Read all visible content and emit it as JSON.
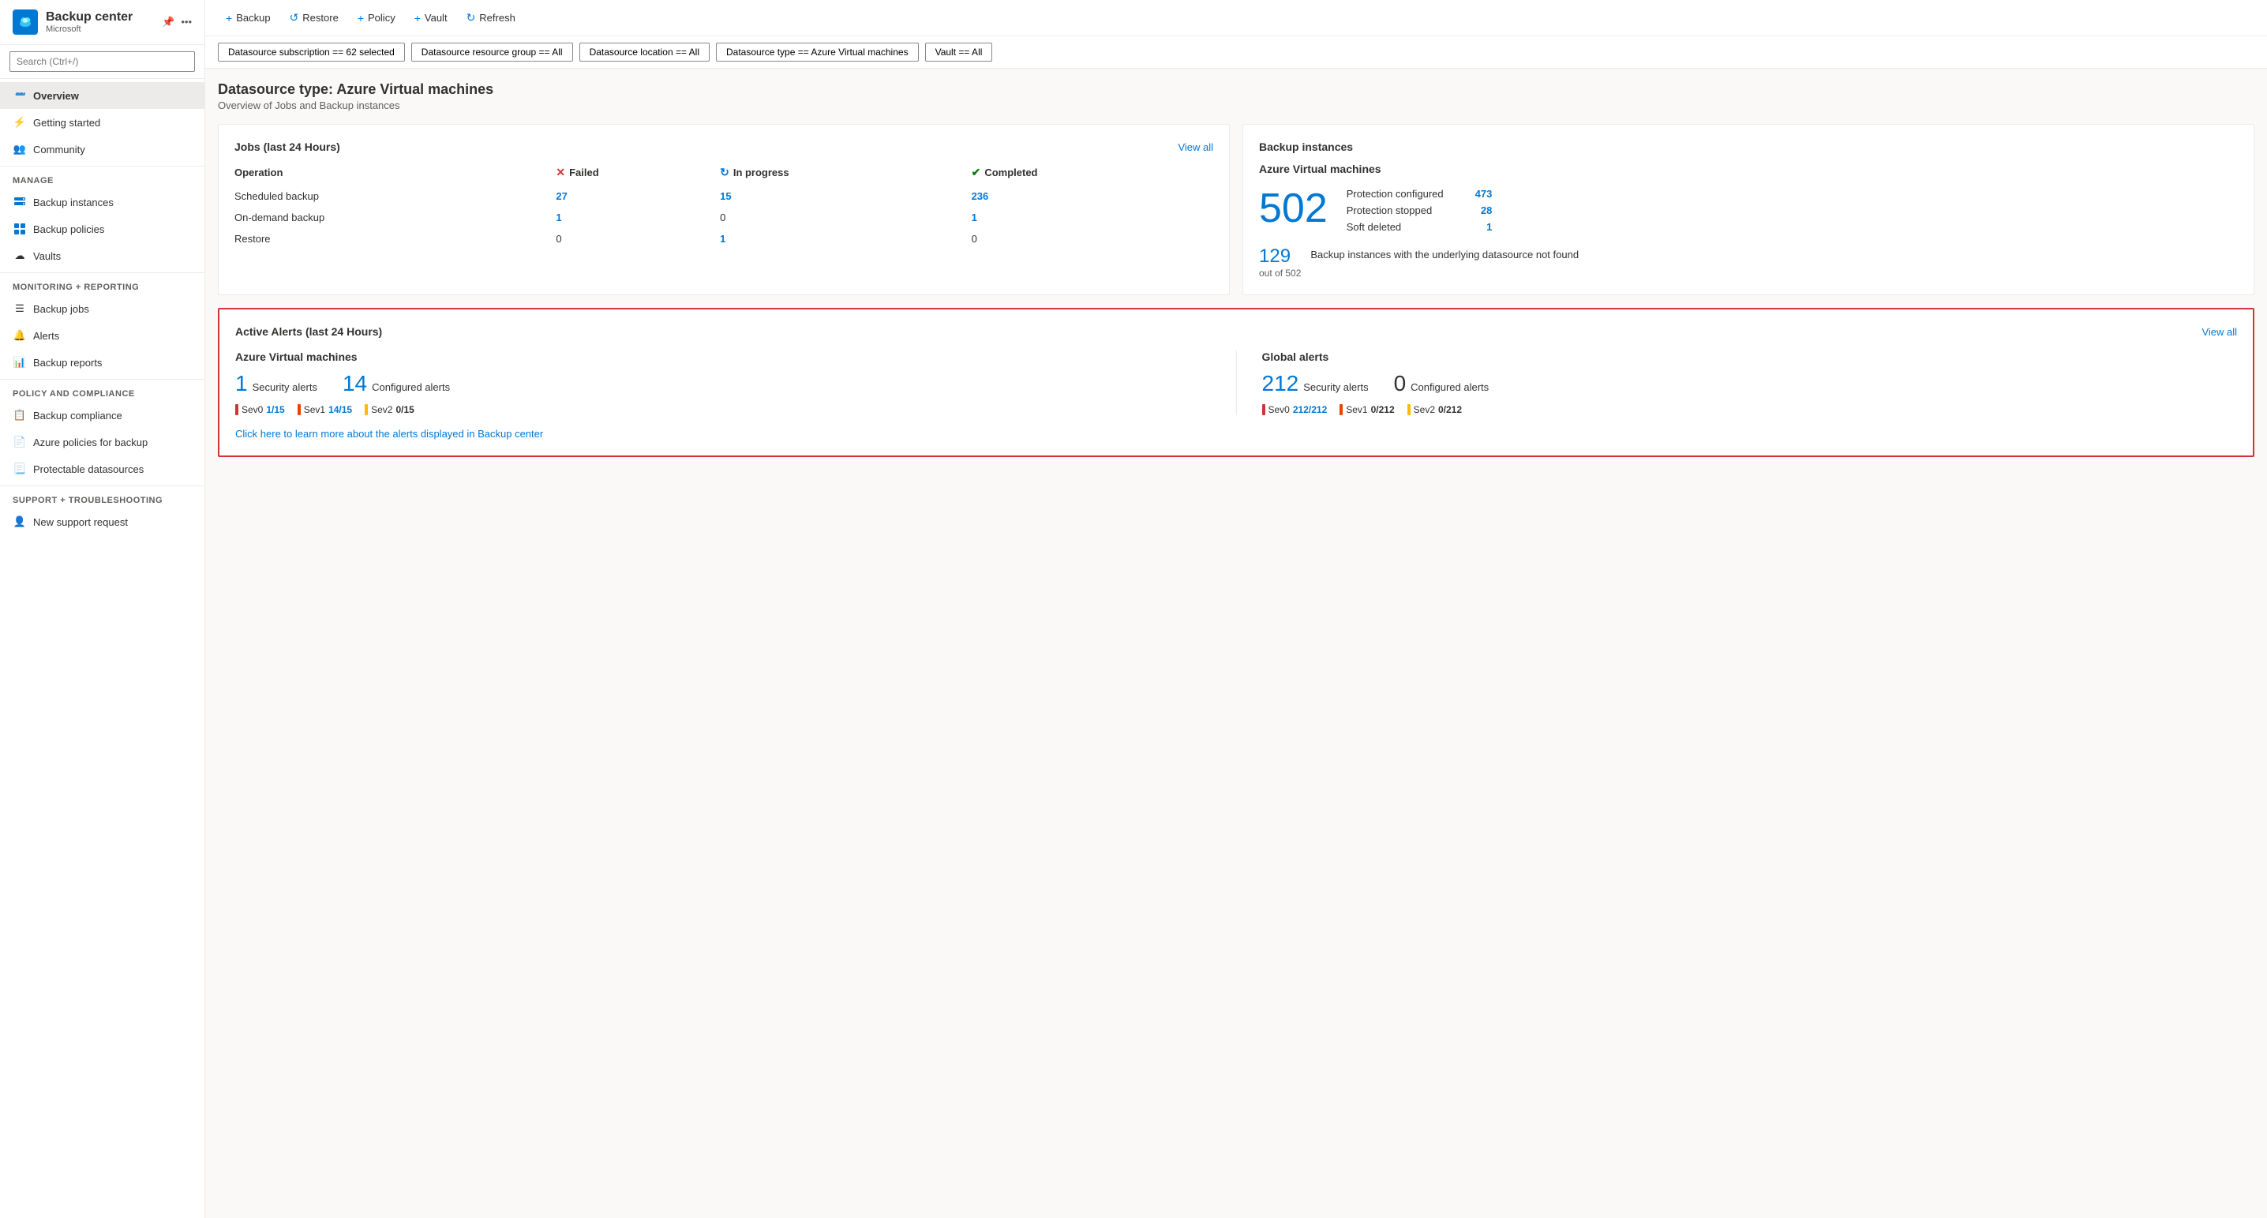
{
  "sidebar": {
    "title": "Backup center",
    "subtitle": "Microsoft",
    "search_placeholder": "Search (Ctrl+/)",
    "nav_items": [
      {
        "id": "overview",
        "label": "Overview",
        "active": true,
        "icon": "cloud"
      },
      {
        "id": "getting-started",
        "label": "Getting started",
        "active": false,
        "icon": "lightning"
      },
      {
        "id": "community",
        "label": "Community",
        "active": false,
        "icon": "people"
      }
    ],
    "sections": [
      {
        "header": "Manage",
        "items": [
          {
            "id": "backup-instances",
            "label": "Backup instances",
            "icon": "server"
          },
          {
            "id": "backup-policies",
            "label": "Backup policies",
            "icon": "grid"
          },
          {
            "id": "vaults",
            "label": "Vaults",
            "icon": "cloud-small"
          }
        ]
      },
      {
        "header": "Monitoring + reporting",
        "items": [
          {
            "id": "backup-jobs",
            "label": "Backup jobs",
            "icon": "list"
          },
          {
            "id": "alerts",
            "label": "Alerts",
            "icon": "alert"
          },
          {
            "id": "backup-reports",
            "label": "Backup reports",
            "icon": "chart"
          }
        ]
      },
      {
        "header": "Policy and compliance",
        "items": [
          {
            "id": "backup-compliance",
            "label": "Backup compliance",
            "icon": "doc-check"
          },
          {
            "id": "azure-policies",
            "label": "Azure policies for backup",
            "icon": "doc"
          },
          {
            "id": "protectable-datasources",
            "label": "Protectable datasources",
            "icon": "doc-list"
          }
        ]
      },
      {
        "header": "Support + troubleshooting",
        "items": [
          {
            "id": "new-support",
            "label": "New support request",
            "icon": "person"
          }
        ]
      }
    ]
  },
  "toolbar": {
    "buttons": [
      {
        "id": "backup",
        "label": "Backup",
        "icon": "+"
      },
      {
        "id": "restore",
        "label": "Restore",
        "icon": "↺"
      },
      {
        "id": "policy",
        "label": "Policy",
        "icon": "+"
      },
      {
        "id": "vault",
        "label": "Vault",
        "icon": "+"
      },
      {
        "id": "refresh",
        "label": "Refresh",
        "icon": "↻"
      }
    ]
  },
  "filters": [
    {
      "id": "subscription",
      "label": "Datasource subscription == 62 selected"
    },
    {
      "id": "resource-group",
      "label": "Datasource resource group == All"
    },
    {
      "id": "location",
      "label": "Datasource location == All"
    },
    {
      "id": "type",
      "label": "Datasource type == Azure Virtual machines"
    },
    {
      "id": "vault",
      "label": "Vault == All"
    }
  ],
  "page_title": "Datasource type: Azure Virtual machines",
  "page_subtitle": "Overview of Jobs and Backup instances",
  "jobs_card": {
    "title": "Jobs (last 24 Hours)",
    "view_all_label": "View all",
    "columns": [
      "Operation",
      "Failed",
      "In progress",
      "Completed"
    ],
    "rows": [
      {
        "operation": "Scheduled backup",
        "failed": "27",
        "in_progress": "15",
        "completed": "236"
      },
      {
        "operation": "On-demand backup",
        "failed": "1",
        "in_progress": "0",
        "completed": "1"
      },
      {
        "operation": "Restore",
        "failed": "0",
        "in_progress": "1",
        "completed": "0"
      }
    ]
  },
  "backup_instances_card": {
    "title": "Backup instances",
    "datasource_label": "Azure Virtual machines",
    "big_num": "502",
    "details": [
      {
        "label": "Protection configured",
        "value": "473"
      },
      {
        "label": "Protection stopped",
        "value": "28"
      },
      {
        "label": "Soft deleted",
        "value": "1"
      }
    ],
    "secondary_num": "129",
    "secondary_denominator": "out of 502",
    "secondary_label": "Backup instances with the underlying datasource not found"
  },
  "alerts_card": {
    "title": "Active Alerts (last 24 Hours)",
    "view_all_label": "View all",
    "azure_col": {
      "title": "Azure Virtual machines",
      "security_count": "1",
      "security_label": "Security alerts",
      "configured_count": "14",
      "configured_label": "Configured alerts",
      "sev_items": [
        {
          "level": "Sev0",
          "value": "1/15",
          "color": "red",
          "highlighted": true
        },
        {
          "level": "Sev1",
          "value": "14/15",
          "color": "orange",
          "highlighted": true
        },
        {
          "level": "Sev2",
          "value": "0/15",
          "color": "yellow",
          "highlighted": false
        }
      ]
    },
    "global_col": {
      "title": "Global alerts",
      "security_count": "212",
      "security_label": "Security alerts",
      "configured_count": "0",
      "configured_label": "Configured alerts",
      "sev_items": [
        {
          "level": "Sev0",
          "value": "212/212",
          "color": "red",
          "highlighted": true
        },
        {
          "level": "Sev1",
          "value": "0/212",
          "color": "orange",
          "highlighted": false
        },
        {
          "level": "Sev2",
          "value": "0/212",
          "color": "yellow",
          "highlighted": false
        }
      ]
    },
    "learn_link": "Click here to learn more about the alerts displayed in Backup center"
  }
}
